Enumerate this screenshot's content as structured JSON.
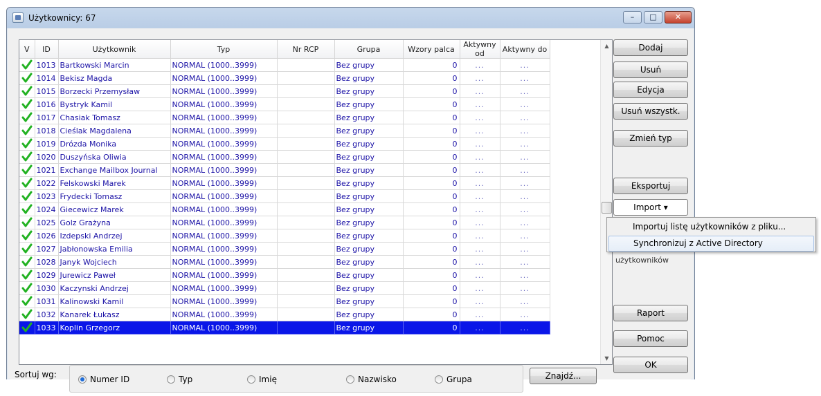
{
  "window": {
    "title": "Użytkownicy: 67",
    "controls": {
      "minimize": "–",
      "maximize": "□",
      "close": "✕"
    }
  },
  "table": {
    "columns": [
      "V",
      "ID",
      "Użytkownik",
      "Typ",
      "Nr RCP",
      "Grupa",
      "Wzory palca",
      "Aktywny od",
      "Aktywny do"
    ],
    "rows": [
      {
        "id": "1013",
        "user": "Bartkowski Marcin",
        "type": "NORMAL (1000..3999)",
        "rcp": "",
        "group": "Bez grupy",
        "patterns": "0",
        "from": "...",
        "to": "..."
      },
      {
        "id": "1014",
        "user": "Bekisz Magda",
        "type": "NORMAL (1000..3999)",
        "rcp": "",
        "group": "Bez grupy",
        "patterns": "0",
        "from": "...",
        "to": "..."
      },
      {
        "id": "1015",
        "user": "Borzecki Przemysław",
        "type": "NORMAL (1000..3999)",
        "rcp": "",
        "group": "Bez grupy",
        "patterns": "0",
        "from": "...",
        "to": "..."
      },
      {
        "id": "1016",
        "user": "Bystryk Kamil",
        "type": "NORMAL (1000..3999)",
        "rcp": "",
        "group": "Bez grupy",
        "patterns": "0",
        "from": "...",
        "to": "..."
      },
      {
        "id": "1017",
        "user": "Chasiak Tomasz",
        "type": "NORMAL (1000..3999)",
        "rcp": "",
        "group": "Bez grupy",
        "patterns": "0",
        "from": "...",
        "to": "..."
      },
      {
        "id": "1018",
        "user": "Cieślak Magdalena",
        "type": "NORMAL (1000..3999)",
        "rcp": "",
        "group": "Bez grupy",
        "patterns": "0",
        "from": "...",
        "to": "..."
      },
      {
        "id": "1019",
        "user": "Drózda Monika",
        "type": "NORMAL (1000..3999)",
        "rcp": "",
        "group": "Bez grupy",
        "patterns": "0",
        "from": "...",
        "to": "..."
      },
      {
        "id": "1020",
        "user": "Duszyńska Oliwia",
        "type": "NORMAL (1000..3999)",
        "rcp": "",
        "group": "Bez grupy",
        "patterns": "0",
        "from": "...",
        "to": "..."
      },
      {
        "id": "1021",
        "user": "Exchange Mailbox Journal",
        "type": "NORMAL (1000..3999)",
        "rcp": "",
        "group": "Bez grupy",
        "patterns": "0",
        "from": "...",
        "to": "..."
      },
      {
        "id": "1022",
        "user": "Felskowski Marek",
        "type": "NORMAL (1000..3999)",
        "rcp": "",
        "group": "Bez grupy",
        "patterns": "0",
        "from": "...",
        "to": "..."
      },
      {
        "id": "1023",
        "user": "Frydecki Tomasz",
        "type": "NORMAL (1000..3999)",
        "rcp": "",
        "group": "Bez grupy",
        "patterns": "0",
        "from": "...",
        "to": "..."
      },
      {
        "id": "1024",
        "user": "Giecewicz Marek",
        "type": "NORMAL (1000..3999)",
        "rcp": "",
        "group": "Bez grupy",
        "patterns": "0",
        "from": "...",
        "to": "..."
      },
      {
        "id": "1025",
        "user": "Golz Grażyna",
        "type": "NORMAL (1000..3999)",
        "rcp": "",
        "group": "Bez grupy",
        "patterns": "0",
        "from": "...",
        "to": "..."
      },
      {
        "id": "1026",
        "user": "Izdepski Andrzej",
        "type": "NORMAL (1000..3999)",
        "rcp": "",
        "group": "Bez grupy",
        "patterns": "0",
        "from": "...",
        "to": "..."
      },
      {
        "id": "1027",
        "user": "Jabłonowska Emilia",
        "type": "NORMAL (1000..3999)",
        "rcp": "",
        "group": "Bez grupy",
        "patterns": "0",
        "from": "...",
        "to": "..."
      },
      {
        "id": "1028",
        "user": "Janyk Wojciech",
        "type": "NORMAL (1000..3999)",
        "rcp": "",
        "group": "Bez grupy",
        "patterns": "0",
        "from": "...",
        "to": "..."
      },
      {
        "id": "1029",
        "user": "Jurewicz Paweł",
        "type": "NORMAL (1000..3999)",
        "rcp": "",
        "group": "Bez grupy",
        "patterns": "0",
        "from": "...",
        "to": "..."
      },
      {
        "id": "1030",
        "user": "Kaczynski Andrzej",
        "type": "NORMAL (1000..3999)",
        "rcp": "",
        "group": "Bez grupy",
        "patterns": "0",
        "from": "...",
        "to": "..."
      },
      {
        "id": "1031",
        "user": "Kalinowski Kamil",
        "type": "NORMAL (1000..3999)",
        "rcp": "",
        "group": "Bez grupy",
        "patterns": "0",
        "from": "...",
        "to": "..."
      },
      {
        "id": "1032",
        "user": "Kanarek Łukasz",
        "type": "NORMAL (1000..3999)",
        "rcp": "",
        "group": "Bez grupy",
        "patterns": "0",
        "from": "...",
        "to": "..."
      },
      {
        "id": "1033",
        "user": "Koplin Grzegorz",
        "type": "NORMAL (1000..3999)",
        "rcp": "",
        "group": "Bez grupy",
        "patterns": "0",
        "from": "...",
        "to": "...",
        "selected": true
      }
    ]
  },
  "buttons": {
    "add": "Dodaj",
    "remove": "Usuń",
    "edit": "Edycja",
    "remove_all": "Usuń wszystk.",
    "change_type": "Zmień typ",
    "export": "Eksportuj",
    "import": "Import ▾",
    "report": "Raport",
    "help": "Pomoc",
    "ok": "OK",
    "find": "Znajdź..."
  },
  "partial_label": "użytkowników",
  "import_menu": {
    "items": [
      "Importuj listę użytkowników z pliku...",
      "Synchronizuj z Active Directory"
    ]
  },
  "sort": {
    "label": "Sortuj wg:",
    "options": [
      "Numer ID",
      "Typ",
      "Imię",
      "Nazwisko",
      "Grupa"
    ],
    "selected": "Numer ID"
  },
  "colors": {
    "text_link": "#1b12a6",
    "selection": "#0a16e8",
    "check": "#22b222"
  },
  "icons": {
    "check": "check-icon",
    "window": "app-icon",
    "scroll_up": "scroll-up-arrow-icon",
    "scroll_down": "scroll-down-arrow-icon"
  }
}
